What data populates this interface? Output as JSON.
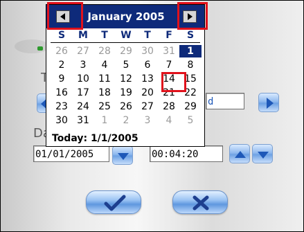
{
  "calendar": {
    "title": "January 2005",
    "weekdays": [
      "S",
      "M",
      "T",
      "W",
      "T",
      "F",
      "S"
    ],
    "weeks": [
      [
        "26",
        "27",
        "28",
        "29",
        "30",
        "31",
        "1"
      ],
      [
        "2",
        "3",
        "4",
        "5",
        "6",
        "7",
        "8"
      ],
      [
        "9",
        "10",
        "11",
        "12",
        "13",
        "14",
        "15"
      ],
      [
        "16",
        "17",
        "18",
        "19",
        "20",
        "21",
        "22"
      ],
      [
        "23",
        "24",
        "25",
        "26",
        "27",
        "28",
        "29"
      ],
      [
        "30",
        "31",
        "1",
        "2",
        "3",
        "4",
        "5"
      ]
    ],
    "selected_day": "1",
    "highlighted_day": "14",
    "today_text": "Today: 1/1/2005"
  },
  "form": {
    "label_t": "T",
    "label_da": "Da",
    "field_partial_value": "d",
    "date_value": "01/01/2005",
    "time_value": "00:04:20"
  },
  "icons": {
    "prev": "left-arrow-icon",
    "next": "right-arrow-icon",
    "ok": "checkmark-icon",
    "cancel": "x-icon"
  },
  "colors": {
    "header_bg": "#0e2a7a",
    "highlight": "#e0111b",
    "accent_blue": "#6ea2e4"
  }
}
